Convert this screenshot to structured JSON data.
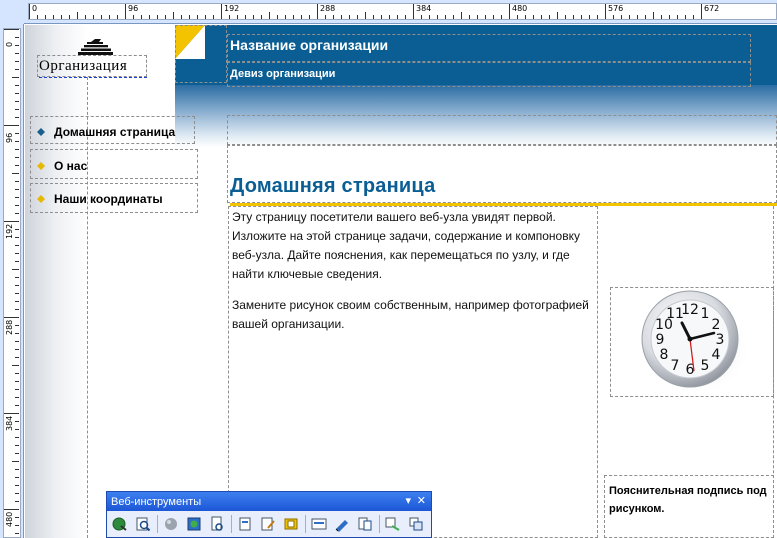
{
  "ruler": {
    "h_labels": [
      "0",
      "96",
      "192",
      "288",
      "384",
      "480",
      "576",
      "672"
    ],
    "v_labels": [
      "0",
      "96",
      "192",
      "288",
      "384",
      "480"
    ]
  },
  "header": {
    "org_name": "Название организации",
    "motto": "Девиз организации"
  },
  "logo": {
    "text": "Организация",
    "icon": "pyramid-logo-icon"
  },
  "nav": {
    "items": [
      {
        "label": "Домашняя страница",
        "bullet_color": "#1a5e8e"
      },
      {
        "label": "О нас",
        "bullet_color": "#e6b800"
      },
      {
        "label": "Наши координаты",
        "bullet_color": "#e6b800"
      }
    ]
  },
  "main": {
    "title": "Домашняя страница",
    "para1": "Эту страницу посетители вашего веб-узла увидят первой. Изложите на этой странице задачи, содержание и компоновку веб-узла. Дайте пояснения, как перемещаться по узлу, и где найти ключевые сведения.",
    "para2": "Замените рисунок своим собственным, например фотографией вашей организации.",
    "caption": "Пояснительная подпись под рисунком."
  },
  "clock": {
    "numerals": [
      "12",
      "1",
      "2",
      "3",
      "4",
      "5",
      "6",
      "7",
      "8",
      "9",
      "10",
      "11"
    ]
  },
  "toolbar": {
    "title": "Веб-инструменты",
    "dropdown_glyph": "▾",
    "close_glyph": "✕",
    "buttons": [
      "insert-hyperlink-icon",
      "preview-icon",
      "web-sphere-icon",
      "hotspot-icon",
      "web-page-options-icon",
      "new-page-icon",
      "page-properties-icon",
      "insert-html-icon",
      "form-properties-icon",
      "edit-link-icon",
      "web-view-icon",
      "web-site-icon",
      "publish-icon"
    ]
  },
  "colors": {
    "brand_blue": "#0a5e94",
    "accent_yellow": "#f3c300"
  }
}
